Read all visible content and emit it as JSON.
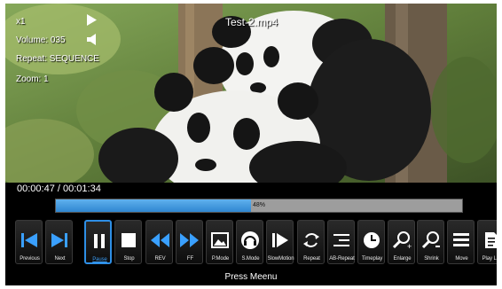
{
  "player": {
    "file_name": "Test-2.mp4",
    "speed": "x1",
    "volume": "Volume: 035",
    "repeat": "Repeat: SEQUENCE",
    "zoom": "Zoom: 1",
    "time": "00:00:47 / 00:01:34",
    "progress_fraction": 0.48,
    "progress_label": "48%"
  },
  "controls": [
    {
      "label": "Previous",
      "icon": "skip-previous-icon"
    },
    {
      "label": "Next",
      "icon": "skip-next-icon"
    },
    {
      "label": "Pause",
      "icon": "pause-icon",
      "active": true
    },
    {
      "label": "Stop",
      "icon": "stop-icon"
    },
    {
      "label": "REV",
      "icon": "rewind-icon"
    },
    {
      "label": "FF",
      "icon": "fast-forward-icon"
    },
    {
      "label": "P.Mode",
      "icon": "picture-mode-icon"
    },
    {
      "label": "S.Mode",
      "icon": "sound-mode-icon"
    },
    {
      "label": "SlowMotion",
      "icon": "slow-motion-icon"
    },
    {
      "label": "Repeat",
      "icon": "repeat-icon"
    },
    {
      "label": "AB-Repeat",
      "icon": "ab-repeat-icon"
    },
    {
      "label": "Timeplay",
      "icon": "clock-icon"
    },
    {
      "label": "Enlarge",
      "icon": "zoom-in-icon"
    },
    {
      "label": "Shrink",
      "icon": "zoom-out-icon"
    },
    {
      "label": "Move",
      "icon": "move-icon"
    },
    {
      "label": "Play List",
      "icon": "playlist-icon"
    }
  ],
  "menu_hint": "Press Meenu",
  "colors": {
    "accent": "#2e8fe6",
    "progress": "#3d9ae3",
    "track": "#9d9d9d"
  }
}
